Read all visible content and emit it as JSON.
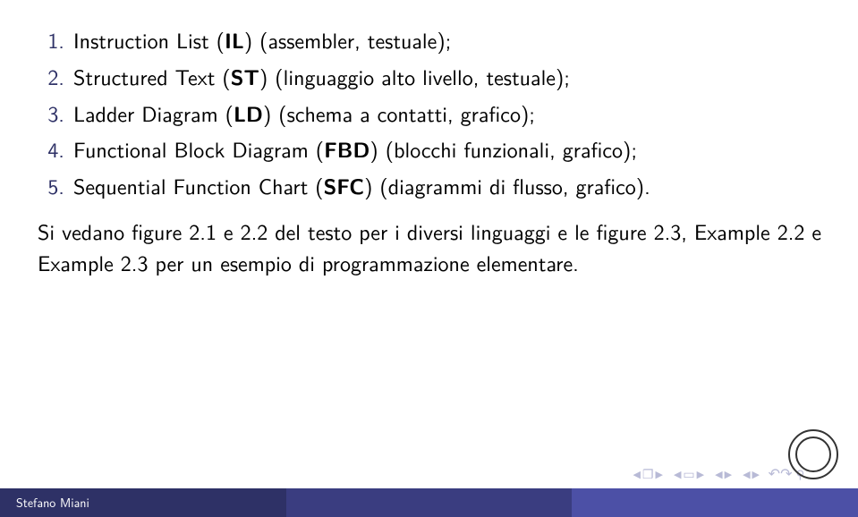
{
  "items": [
    {
      "num": "1.",
      "pre": "Instruction List (",
      "bold": "IL",
      "post": ") (assembler, testuale);"
    },
    {
      "num": "2.",
      "pre": "Structured Text (",
      "bold": "ST",
      "post": ") (linguaggio alto livello, testuale);"
    },
    {
      "num": "3.",
      "pre": "Ladder Diagram (",
      "bold": "LD",
      "post": ") (schema a contatti, grafico);"
    },
    {
      "num": "4.",
      "pre": "Functional Block Diagram (",
      "bold": "FBD",
      "post": ") (blocchi funzionali, grafico);"
    },
    {
      "num": "5.",
      "pre": "Sequential Function Chart (",
      "bold": "SFC",
      "post": ") (diagrammi di flusso, grafico)."
    }
  ],
  "paragraph": "Si vedano figure 2.1 e 2.2 del testo per i diversi linguaggi e le figure 2.3, Example 2.2 e Example 2.3 per un esempio di programmazione elementare.",
  "footer": {
    "author": "Stefano Miani"
  },
  "nav": {
    "back_slide": "◀",
    "fwd_slide": "▶",
    "back_frame": "◀",
    "fwd_frame": "▶",
    "back_sub": "◀",
    "fwd_sub": "▶",
    "back_sec": "◀",
    "fwd_sec": "▶",
    "frame_icon": "❐",
    "overlay_icon": "▭",
    "undo": "↶",
    "redo": "↷",
    "magnify": "⚲"
  }
}
